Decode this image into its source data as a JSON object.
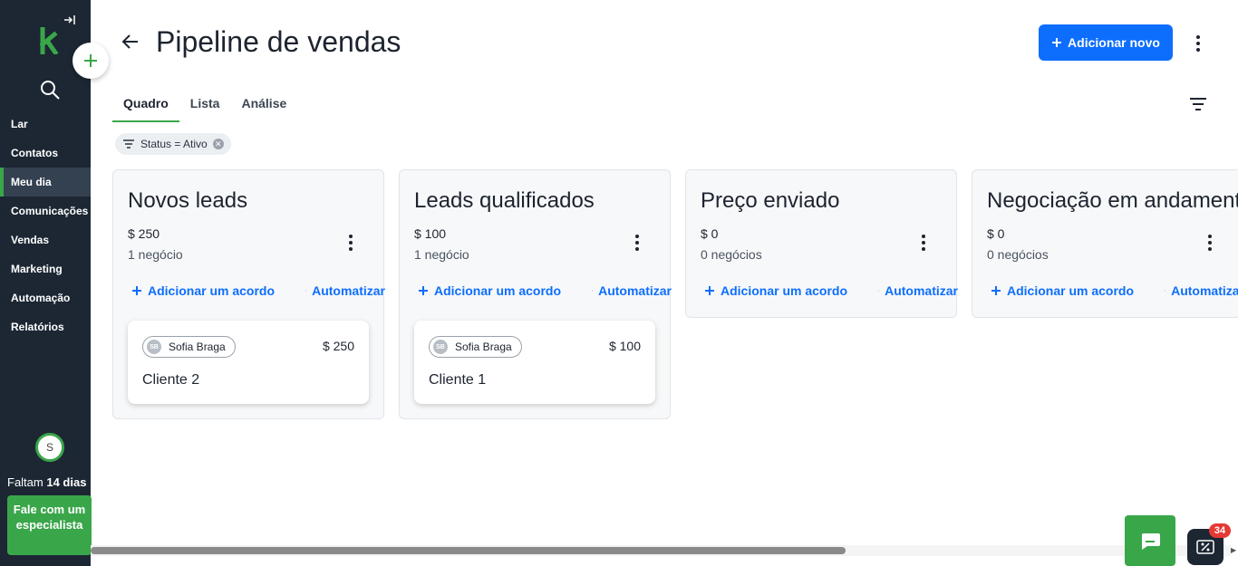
{
  "sidebar": {
    "nav": [
      {
        "label": "Lar",
        "active": false
      },
      {
        "label": "Contatos",
        "active": false
      },
      {
        "label": "Meu dia",
        "active": true
      },
      {
        "label": "Comunicações",
        "active": false
      },
      {
        "label": "Vendas",
        "active": false
      },
      {
        "label": "Marketing",
        "active": false
      },
      {
        "label": "Automação",
        "active": false
      },
      {
        "label": "Relatórios",
        "active": false
      }
    ],
    "avatar_initial": "S",
    "trial_prefix": "Faltam ",
    "trial_days": "14 dias",
    "expert_button": "Fale com um especialista"
  },
  "header": {
    "title": "Pipeline de vendas",
    "add_new": "Adicionar novo"
  },
  "tabs": [
    {
      "label": "Quadro",
      "active": true
    },
    {
      "label": "Lista",
      "active": false
    },
    {
      "label": "Análise",
      "active": false
    }
  ],
  "filter_chip": "Status = Ativo",
  "columns": [
    {
      "title": "Novos leads",
      "amount": "$ 250",
      "count": "1 negócio",
      "add_label": "Adicionar um acordo",
      "auto_label": "Automatizar",
      "deals": [
        {
          "owner_initials": "SB",
          "owner": "Sofia Braga",
          "value": "$ 250",
          "name": "Cliente 2"
        }
      ]
    },
    {
      "title": "Leads qualificados",
      "amount": "$ 100",
      "count": "1 negócio",
      "add_label": "Adicionar um acordo",
      "auto_label": "Automatizar",
      "deals": [
        {
          "owner_initials": "SB",
          "owner": "Sofia Braga",
          "value": "$ 100",
          "name": "Cliente 1"
        }
      ]
    },
    {
      "title": "Preço enviado",
      "amount": "$ 0",
      "count": "0 negócios",
      "add_label": "Adicionar um acordo",
      "auto_label": "Automatizar",
      "deals": []
    },
    {
      "title": "Negociação em andamento",
      "amount": "$ 0",
      "count": "0 negócios",
      "add_label": "Adicionar um acordo",
      "auto_label": "Automatizar",
      "deals": []
    }
  ],
  "promo_badge": "34",
  "colors": {
    "sidebar_bg": "#1c2733",
    "brand_green": "#3aa64a",
    "primary_blue": "#0d6efd"
  }
}
